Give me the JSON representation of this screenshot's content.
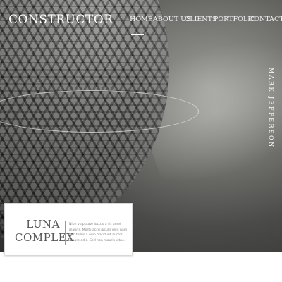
{
  "header": {
    "logo": "CONSTRUCTOR"
  },
  "nav": {
    "items": [
      {
        "label": "HOME",
        "active": true
      },
      {
        "label": "ABOUT US",
        "active": false
      },
      {
        "label": "CLIENTS",
        "active": false
      },
      {
        "label": "PORTFOLIO",
        "active": false
      },
      {
        "label": "CONTACT",
        "active": false
      }
    ]
  },
  "hero": {
    "vertical_name": "MARK JEFFERSON"
  },
  "card": {
    "title_line1": "LUNA",
    "title_line2": "COMPLEX",
    "text": "Nibh vulputate luctus a sit amet mauris. Morbi accu ipsum velit nam nec tellus a odio tincidunt auctor ornare odio. Sed non mauris vitae."
  },
  "colors": {
    "nav_text": "#f2f2f2",
    "card_bg": "#ffffff",
    "card_title": "#555555"
  }
}
